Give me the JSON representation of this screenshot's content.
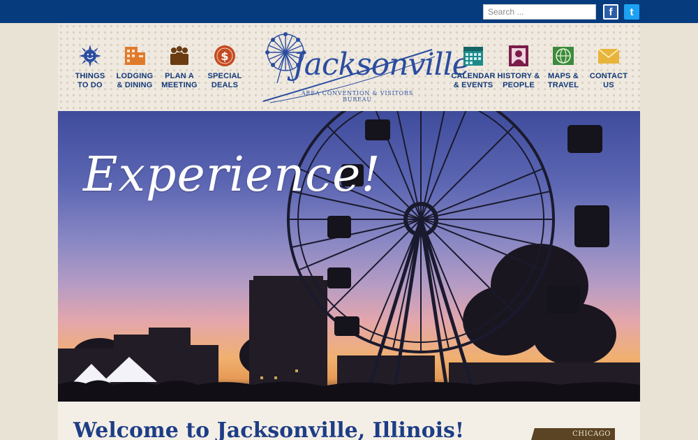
{
  "topbar": {
    "search_placeholder": "Search ...",
    "facebook_label": "f",
    "twitter_label": "t"
  },
  "nav_left": [
    {
      "label": "THINGS\nTO DO",
      "icon": "sun-icon",
      "color": "#2b4da0"
    },
    {
      "label": "LODGING\n& DINING",
      "icon": "building-icon",
      "color": "#e07a2b"
    },
    {
      "label": "PLAN A\nMEETING",
      "icon": "people-icon",
      "color": "#6b3b12"
    },
    {
      "label": "SPECIAL\nDEALS",
      "icon": "dollar-icon",
      "color": "#c44a22"
    }
  ],
  "nav_right": [
    {
      "label": "CALENDAR\n& EVENTS",
      "icon": "calendar-icon",
      "color": "#1d8a8a"
    },
    {
      "label": "HISTORY &\nPEOPLE",
      "icon": "portrait-icon",
      "color": "#7a1d4a"
    },
    {
      "label": "MAPS &\nTRAVEL",
      "icon": "globe-icon",
      "color": "#3c8a3c"
    },
    {
      "label": "CONTACT\nUS",
      "icon": "envelope-icon",
      "color": "#e8b43a"
    }
  ],
  "logo": {
    "wordmark": "Jacksonville",
    "subtitle": "AREA CONVENTION & VISITORS BUREAU"
  },
  "hero": {
    "title": "Experience!"
  },
  "welcome": {
    "heading": "Welcome to Jacksonville, Illinois!"
  },
  "side_tab": {
    "label": "CHICAGO"
  },
  "colors": {
    "topbar": "#063b7e",
    "nav_text": "#13397a",
    "heading": "#1d3d86"
  }
}
